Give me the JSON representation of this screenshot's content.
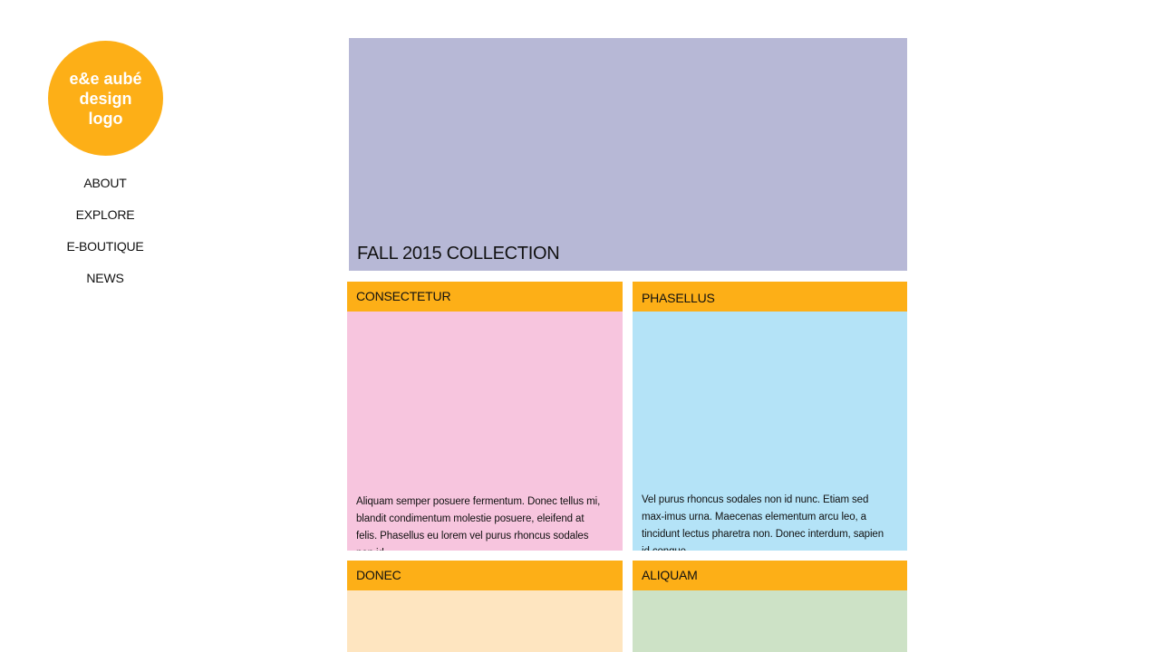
{
  "logo": {
    "text": "e&e aubé design logo",
    "color": "#FDAF17"
  },
  "nav": {
    "items": [
      {
        "label": "ABOUT"
      },
      {
        "label": "EXPLORE"
      },
      {
        "label": "E-BOUTIQUE"
      },
      {
        "label": "NEWS"
      }
    ]
  },
  "hero": {
    "title": "FALL 2015 COLLECTION",
    "color": "#B7B8D6"
  },
  "cards": [
    {
      "title": "CONSECTETUR",
      "text": "Aliquam semper posuere fermentum. Donec tellus mi, blandit condimentum molestie posuere, eleifend at felis. Phasellus eu lorem vel purus rhoncus sodales non id",
      "color": "#F7C5DE"
    },
    {
      "title": "PHASELLUS",
      "text": "Vel purus rhoncus sodales non id nunc. Etiam sed max-imus urna. Maecenas elementum arcu leo, a tincidunt lectus pharetra non. Donec interdum, sapien id congue",
      "color": "#B4E3F7"
    },
    {
      "title": "DONEC",
      "text": "",
      "color": "#FEE5C0"
    },
    {
      "title": "ALIQUAM",
      "text": "",
      "color": "#CDE2C6"
    }
  ],
  "accent_color": "#FDAF17"
}
